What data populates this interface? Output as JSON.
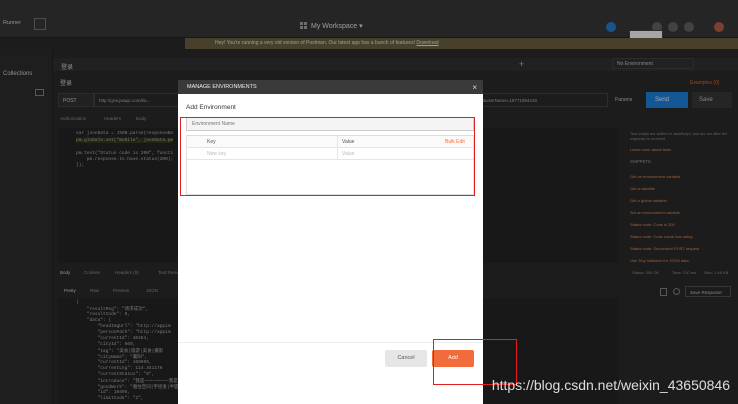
{
  "app": {
    "runner_label": "Runner",
    "workspace_label": "My Workspace"
  },
  "banner": {
    "text": "Hey! You're running a very old version of Postman. Our latest app has a bunch of features!",
    "link": "Download"
  },
  "sidebar": {
    "collections_label": "Collections"
  },
  "request": {
    "title": "登录",
    "method": "POST",
    "url": "http://gzw.jwaqc.com/ka...",
    "url_tail": "&userName=18771094419",
    "params_label": "Params",
    "send_label": "Send",
    "save_label": "Save",
    "examples_label": "Examples (0)",
    "env_select": "No Environment",
    "subtabs": [
      "Authorization",
      "Headers",
      "Body",
      "Pre-request Script",
      "Tests"
    ]
  },
  "code_lines": [
    "var jsonData = JSON.parse(responseBo",
    "pm.globals.set(\"mobile\", jsonData.pe",
    "",
    "pm.test(\"Status code is 200\", functi",
    "    pm.response.to.have.status(200);",
    "});"
  ],
  "response": {
    "tabs": [
      "Body",
      "Cookies",
      "Headers (9)",
      "Test Results"
    ],
    "view_modes": [
      "Pretty",
      "Raw",
      "Preview",
      "JSON"
    ],
    "status": "Status: 200 OK",
    "time": "Time: 210 ms",
    "size": "Size: 1.46 KB",
    "save_response": "Save Response",
    "lines": [
      "{",
      "    \"resultMsg\": \"请求成功\",",
      "    \"resultCode\": 0,",
      "    \"data\": {",
      "        \"headImgUrl\": \"http://appim",
      "        \"personPath\": \"http://appim",
      "        \"currentId\": 40454,",
      "        \"cityId\": 669,",
      "        \"tag\": \"美食|旅游|美食|摄影",
      "        \"cityName\": \"襄阳\",",
      "        \"currentId\": 169965,",
      "        \"currentLng\": 114.341176",
      "        \"currentStatus\": \"0\",",
      "        \"introduce\": \"我是~~~~~~~~~我是贵州下手亏欠撞客\",",
      "        \"goodWork\": \"雅住空间|宇径发|半面网小区|地铁景\",",
      "        \"id\": 10495,",
      "        \"limitCode\": \"2\","
    ]
  },
  "right_panel": {
    "intro": "Test scripts are written in JavaScript, and are run after the response is received.",
    "learn_more": "Learn more about tests",
    "snippets_label": "SNIPPETS",
    "snippets": [
      "Get an environment variable",
      "Get a variable",
      "Get a global variable",
      "Set an environment variable",
      "Set a global variable",
      "Clear an environment variable",
      "Response body: Contains string",
      "Response body: JSON value check",
      "Response body: Is equal to a string",
      "Response headers: Content-Type header check",
      "Response time is less than 200ms",
      "Status code: Code is 200",
      "Status code: Code name has string",
      "Status code: Successful POST request",
      "Use Tiny Validator for JSON data"
    ]
  },
  "modal": {
    "title": "MANAGE ENVIRONMENTS",
    "close": "×",
    "heading": "Add Environment",
    "name_placeholder": "Environment Name",
    "col_key": "Key",
    "col_value": "Value",
    "bulk_edit": "Bulk Edit",
    "key_placeholder": "New key",
    "value_placeholder": "Value",
    "cancel_label": "Cancel",
    "add_label": "Add"
  },
  "watermark": "https://blog.csdn.net/weixin_43650846",
  "colors": {
    "accent": "#f26b3a",
    "send": "#1e88e5",
    "annotation": "#e02020"
  }
}
